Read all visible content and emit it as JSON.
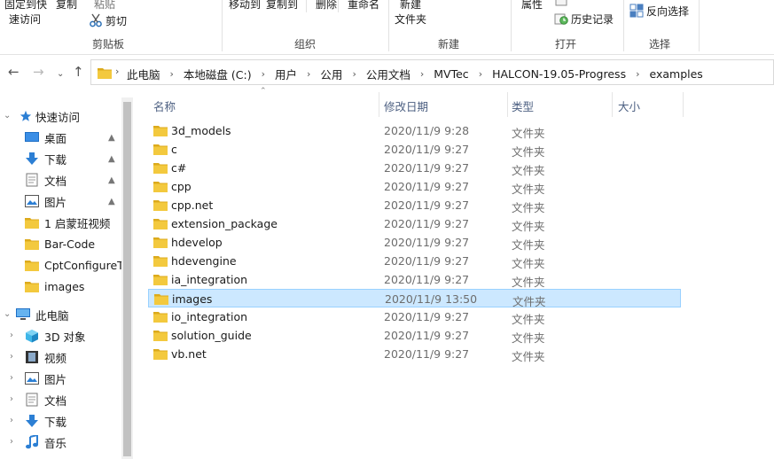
{
  "ribbon": {
    "clipboard": {
      "pin_quick": "固定到快",
      "pin_quick_line2": "速访问",
      "copy": "复制",
      "paste": "粘贴",
      "cut": "剪切",
      "group_label": "剪贴板"
    },
    "organize": {
      "move_to": "移动到",
      "copy_to": "复制到",
      "delete": "删除",
      "rename": "重命名",
      "group_label": "组织"
    },
    "new": {
      "new_folder": "新建",
      "new_folder_line2": "文件夹",
      "group_label": "新建"
    },
    "open": {
      "properties": "属性",
      "history": "历史记录",
      "group_label": "打开"
    },
    "select": {
      "invert": "反向选择",
      "group_label": "选择"
    }
  },
  "address": {
    "breadcrumbs": [
      "此电脑",
      "本地磁盘 (C:)",
      "用户",
      "公用",
      "公用文档",
      "MVTec",
      "HALCON-19.05-Progress",
      "examples"
    ]
  },
  "sidebar": {
    "quick_access": "快速访问",
    "quick_items": [
      {
        "label": "桌面",
        "icon": "desktop-icon",
        "pinned": true
      },
      {
        "label": "下载",
        "icon": "download-icon",
        "pinned": true
      },
      {
        "label": "文档",
        "icon": "document-icon",
        "pinned": true
      },
      {
        "label": "图片",
        "icon": "picture-icon",
        "pinned": true
      },
      {
        "label": "1 启蒙班视频",
        "icon": "folder-icon",
        "pinned": false
      },
      {
        "label": "Bar-Code",
        "icon": "folder-icon",
        "pinned": false
      },
      {
        "label": "CptConfigureTe",
        "icon": "folder-icon",
        "pinned": false
      },
      {
        "label": "images",
        "icon": "folder-icon",
        "pinned": false
      }
    ],
    "this_pc": "此电脑",
    "pc_items": [
      {
        "label": "3D 对象",
        "icon": "cube-icon"
      },
      {
        "label": "视频",
        "icon": "video-icon"
      },
      {
        "label": "图片",
        "icon": "picture-icon"
      },
      {
        "label": "文档",
        "icon": "document-icon"
      },
      {
        "label": "下载",
        "icon": "download-icon"
      },
      {
        "label": "音乐",
        "icon": "music-icon"
      }
    ]
  },
  "columns": {
    "name": "名称",
    "date": "修改日期",
    "type": "类型",
    "size": "大小"
  },
  "files": [
    {
      "name": "3d_models",
      "date": "2020/11/9 9:28",
      "type": "文件夹"
    },
    {
      "name": "c",
      "date": "2020/11/9 9:27",
      "type": "文件夹"
    },
    {
      "name": "c#",
      "date": "2020/11/9 9:27",
      "type": "文件夹"
    },
    {
      "name": "cpp",
      "date": "2020/11/9 9:27",
      "type": "文件夹"
    },
    {
      "name": "cpp.net",
      "date": "2020/11/9 9:27",
      "type": "文件夹"
    },
    {
      "name": "extension_package",
      "date": "2020/11/9 9:27",
      "type": "文件夹"
    },
    {
      "name": "hdevelop",
      "date": "2020/11/9 9:27",
      "type": "文件夹"
    },
    {
      "name": "hdevengine",
      "date": "2020/11/9 9:27",
      "type": "文件夹"
    },
    {
      "name": "ia_integration",
      "date": "2020/11/9 9:27",
      "type": "文件夹"
    },
    {
      "name": "images",
      "date": "2020/11/9 13:50",
      "type": "文件夹",
      "selected": true
    },
    {
      "name": "io_integration",
      "date": "2020/11/9 9:27",
      "type": "文件夹"
    },
    {
      "name": "solution_guide",
      "date": "2020/11/9 9:27",
      "type": "文件夹"
    },
    {
      "name": "vb.net",
      "date": "2020/11/9 9:27",
      "type": "文件夹"
    }
  ],
  "colors": {
    "folder": "#f3c93e",
    "folder_dark": "#dcaa1c",
    "selection_bg": "#cce8ff",
    "selection_border": "#99d1ff",
    "header_text": "#4d6082"
  }
}
